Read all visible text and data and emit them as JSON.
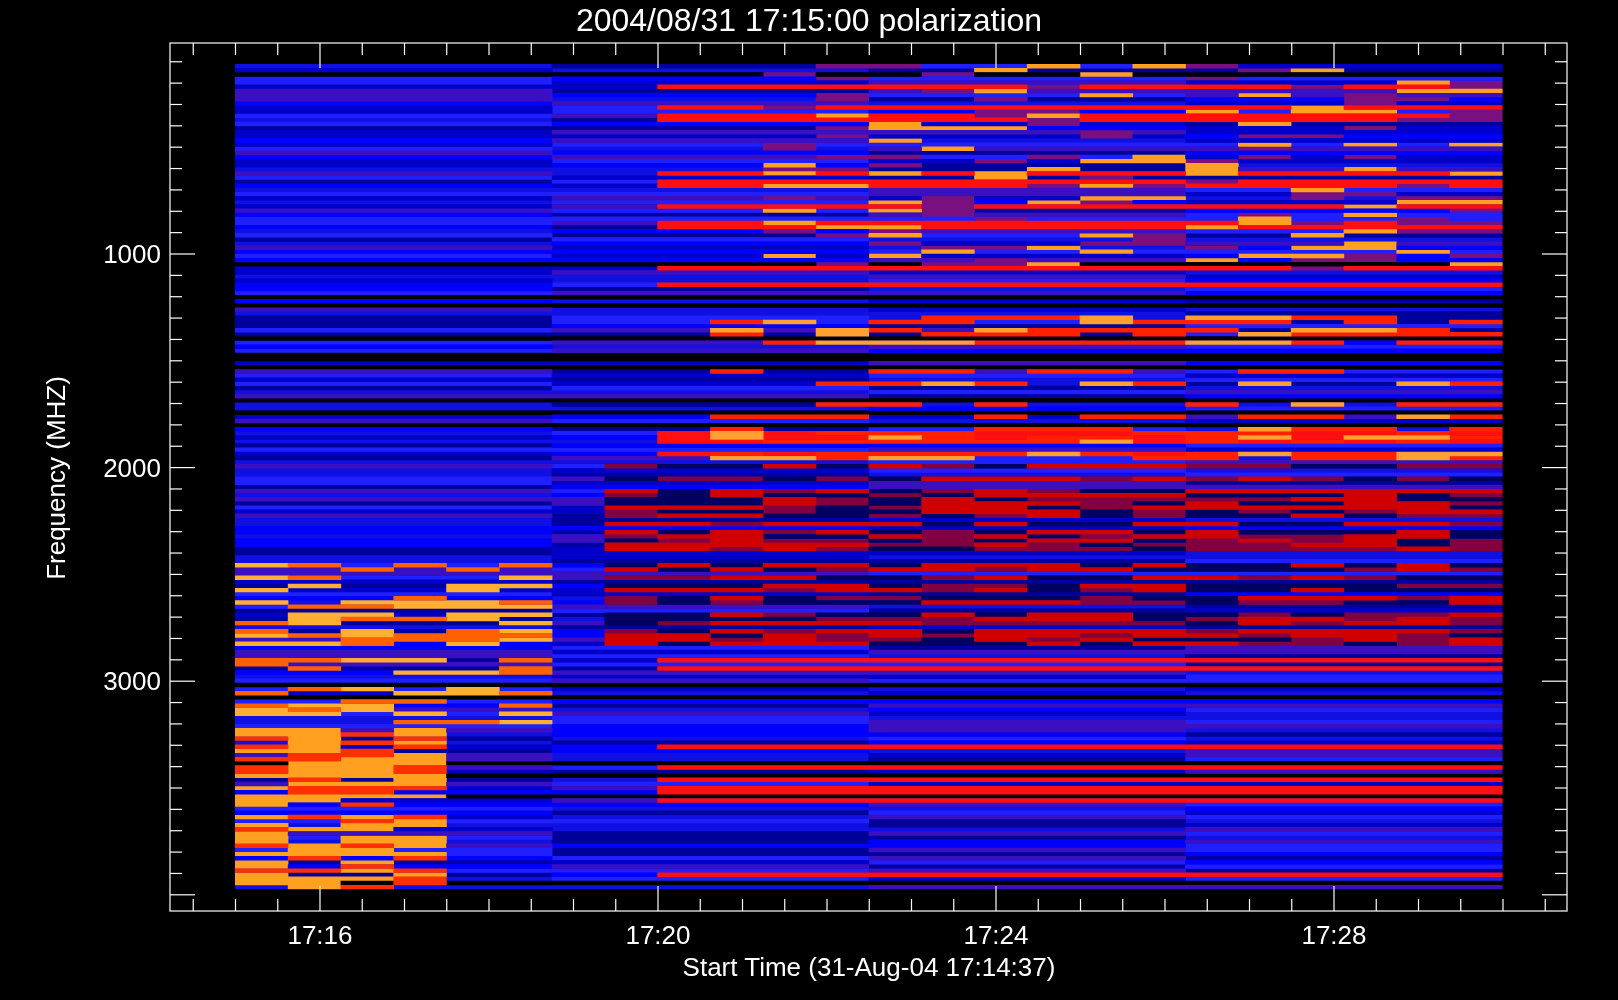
{
  "title": "2004/08/31 17:15:00 polarization",
  "x_axis": {
    "label": "Start Time (31-Aug-04 17:14:37)",
    "ticks": [
      "17:16",
      "17:20",
      "17:24",
      "17:28"
    ]
  },
  "y_axis": {
    "label": "Frequency (MHZ)",
    "ticks": [
      "1000",
      "2000",
      "3000"
    ]
  }
}
